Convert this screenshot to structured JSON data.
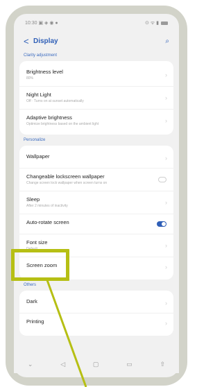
{
  "status": {
    "time": "10:30 ▣ ◈ ◉ ●",
    "icons": "⊙ ᯤ ▮"
  },
  "header": {
    "title": "Display",
    "back": "<",
    "search": "⌕"
  },
  "sections": [
    {
      "label": "Clarity adjustment",
      "items": [
        {
          "title": "Brightness level",
          "sub": "80%"
        },
        {
          "title": "Night Light",
          "sub": "Off · Turns on at sunset automatically"
        },
        {
          "title": "Adaptive brightness",
          "sub": "Optimize brightness based on the ambient light"
        }
      ]
    },
    {
      "label": "Personalize",
      "items": [
        {
          "title": "Wallpaper",
          "sub": ""
        },
        {
          "title": "Changeable lockscreen wallpaper",
          "sub": "Change screen lock wallpaper when screen turns on"
        },
        {
          "title": "Sleep",
          "sub": "After 2 minutes of inactivity"
        },
        {
          "title": "Auto-rotate screen",
          "sub": ""
        },
        {
          "title": "Font size",
          "sub": "Default"
        },
        {
          "title": "Screen zoom",
          "sub": ""
        }
      ]
    },
    {
      "label": "Others",
      "items": [
        {
          "title": "Dark",
          "sub": ""
        },
        {
          "title": "Printing",
          "sub": ""
        }
      ]
    }
  ],
  "navbar": {
    "down": "⌄",
    "back": "◁",
    "home": "▢",
    "recent": "▭",
    "extra": "⇧"
  },
  "colors": {
    "accent": "#2f5fb7",
    "highlight": "#b6bf14",
    "frame": "#d2d3c9"
  }
}
